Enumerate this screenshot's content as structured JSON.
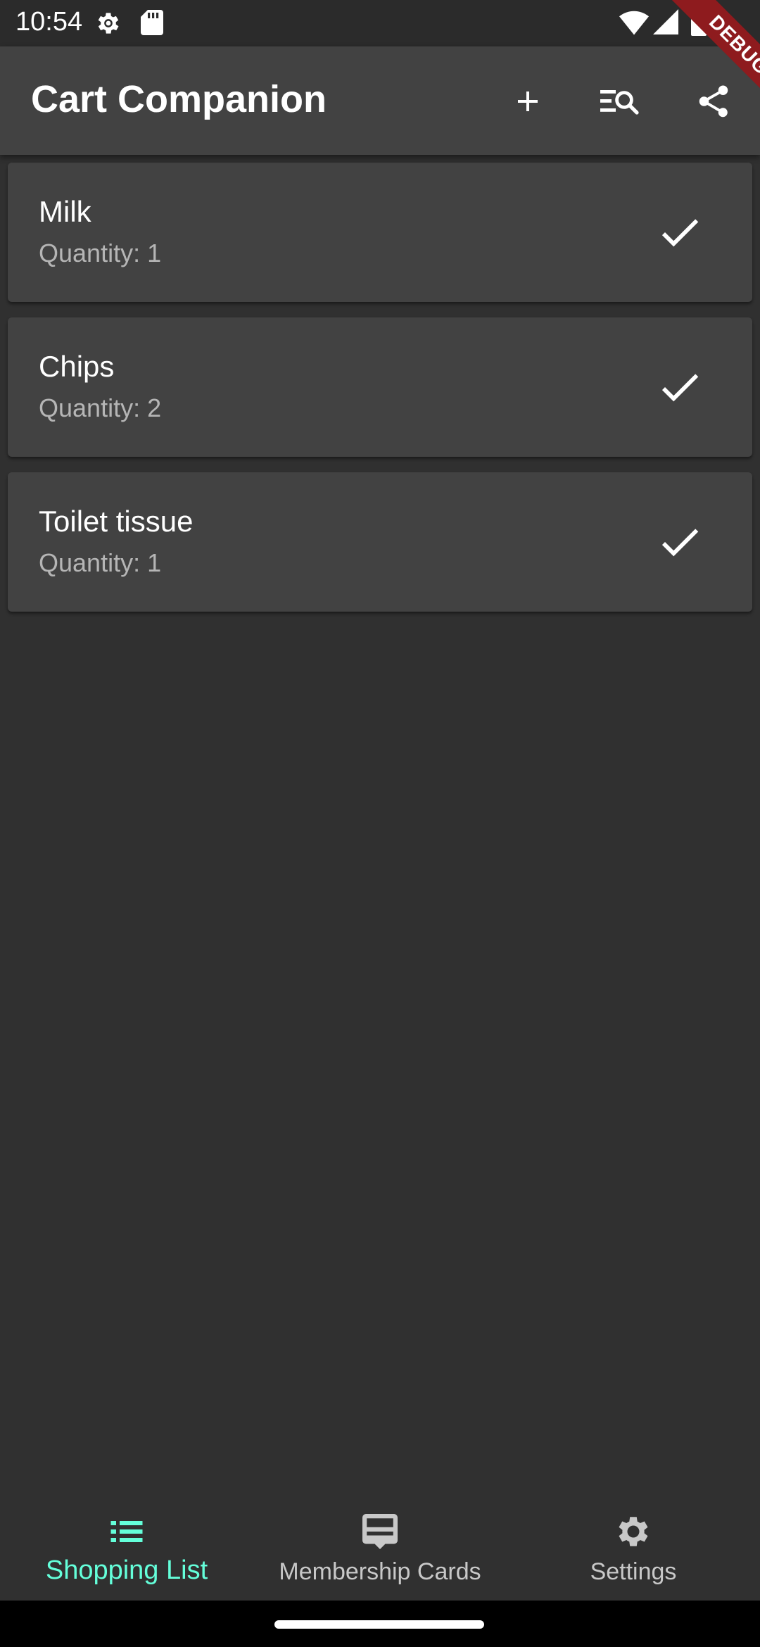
{
  "status_bar": {
    "time": "10:54"
  },
  "app_bar": {
    "title": "Cart Companion",
    "actions": [
      "add-icon",
      "search-list-icon",
      "share-icon"
    ]
  },
  "debug_banner": "DEBUG",
  "shopping_list": [
    {
      "name": "Milk",
      "quantity": "Quantity: 1"
    },
    {
      "name": "Chips",
      "quantity": "Quantity: 2"
    },
    {
      "name": "Toilet tissue",
      "quantity": "Quantity: 1"
    }
  ],
  "bottom_nav": {
    "items": [
      {
        "label": "Shopping List",
        "icon": "list-icon",
        "active": true
      },
      {
        "label": "Membership Cards",
        "icon": "card-icon",
        "active": false
      },
      {
        "label": "Settings",
        "icon": "settings-icon",
        "active": false
      }
    ]
  },
  "colors": {
    "background": "#303030",
    "surface": "#424242",
    "accent": "#64ffda",
    "debug": "#8e1b1e"
  }
}
